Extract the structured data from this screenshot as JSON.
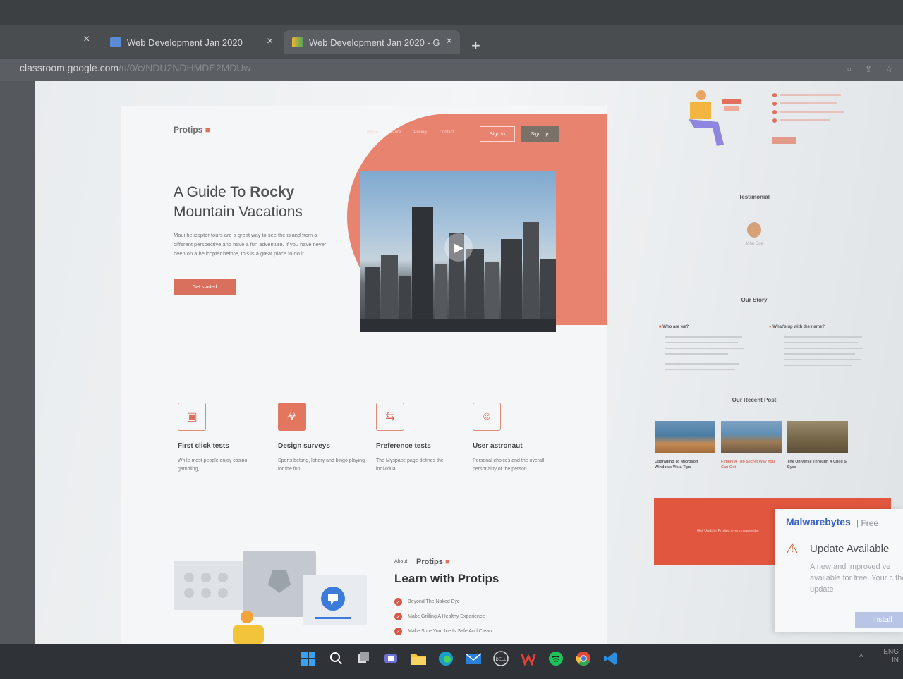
{
  "browser": {
    "tabs": [
      {
        "label": "Web Development Jan 2020",
        "close": "×"
      },
      {
        "label": "Web Development Jan 2020 - G",
        "close": "×"
      }
    ],
    "first_close": "×",
    "new_tab": "+",
    "url_host": "classroom.google.com",
    "url_path": "/u/0/c/NDU2NDHMDE2MDUw"
  },
  "site": {
    "logo": "Protips",
    "logo_dot": "■",
    "nav": [
      "Home",
      "Store",
      "Pricing",
      "Contact"
    ],
    "signin": "Sign In",
    "signup": "Sign Up",
    "hero_title_1": "A Guide To ",
    "hero_title_bold": "Rocky",
    "hero_title_2": "Mountain Vacations",
    "hero_text": "Maui helicopter tours are a great way to see the island from a different perspective and have a fun adventure. If you have never been on a helicopter before, this is a great place to do it.",
    "cta": "Get started",
    "play_icon": "▶",
    "features": [
      {
        "icon": "▣",
        "title": "First click tests",
        "desc": "While most people enjoy casino gambling,"
      },
      {
        "icon": "☣",
        "title": "Design surveys",
        "desc": "Sports betting, lottery and bingo playing for the fun"
      },
      {
        "icon": "⇆",
        "title": "Preference tests",
        "desc": "The Myspace page defines the individual."
      },
      {
        "icon": "☺",
        "title": "User astronaut",
        "desc": "Personal choices and the overall personality of the person."
      }
    ],
    "about_label": "About",
    "about_brand": "Protips",
    "about_title": "Learn with Protips",
    "about_items": [
      "Beyond The Naked Eye",
      "Make Grilling A Healthy Experience",
      "Make Sure Your Ice Is Safe And Clean"
    ],
    "check": "✓"
  },
  "side": {
    "testimonial": "Testimonial",
    "testimonial_name": "John Doe",
    "our_story": "Our Story",
    "who_are_we": "Who are we?",
    "whats_up": "What's up with the name?",
    "recent_post": "Our Recent Post",
    "posts": [
      {
        "title": "Upgrading To Microsoft Windows Vista Tips"
      },
      {
        "title": "Finally A Top Secret Way You Can Get"
      },
      {
        "title": "The Universe Through A Child S Eyes"
      }
    ],
    "newsletter": "Get Update Protips every newsletter"
  },
  "toast": {
    "brand": "Malwarebytes",
    "separator": "|",
    "tier": "Free",
    "title": "Update Available",
    "body": "A new and improved ve available for free. Your c the update",
    "install": "Install",
    "warn_icon": "⚠"
  },
  "taskbar": {
    "icons": [
      "windows-start",
      "search",
      "task-view",
      "teams-chat",
      "file-explorer",
      "edge",
      "mail",
      "dell",
      "wps-office",
      "spotify",
      "chrome",
      "vscode"
    ],
    "lang_1": "ENG",
    "lang_2": "IN",
    "chevron": "^"
  },
  "colors": {
    "accent": "#e2705c",
    "accent_dark": "#d9584a",
    "malwarebytes_blue": "#3963c4"
  }
}
